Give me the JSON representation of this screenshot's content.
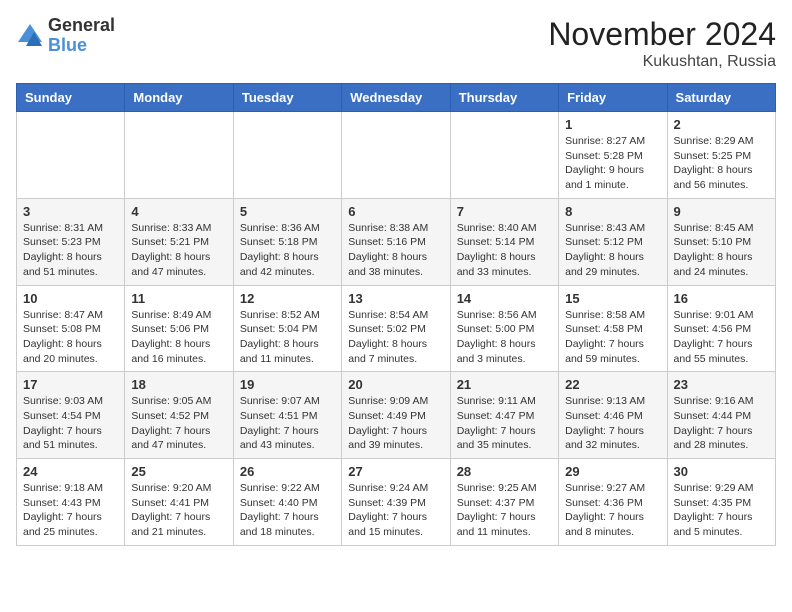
{
  "logo": {
    "general": "General",
    "blue": "Blue"
  },
  "title": "November 2024",
  "location": "Kukushtan, Russia",
  "days_header": [
    "Sunday",
    "Monday",
    "Tuesday",
    "Wednesday",
    "Thursday",
    "Friday",
    "Saturday"
  ],
  "weeks": [
    [
      {
        "day": "",
        "info": ""
      },
      {
        "day": "",
        "info": ""
      },
      {
        "day": "",
        "info": ""
      },
      {
        "day": "",
        "info": ""
      },
      {
        "day": "",
        "info": ""
      },
      {
        "day": "1",
        "info": "Sunrise: 8:27 AM\nSunset: 5:28 PM\nDaylight: 9 hours and 1 minute."
      },
      {
        "day": "2",
        "info": "Sunrise: 8:29 AM\nSunset: 5:25 PM\nDaylight: 8 hours and 56 minutes."
      }
    ],
    [
      {
        "day": "3",
        "info": "Sunrise: 8:31 AM\nSunset: 5:23 PM\nDaylight: 8 hours and 51 minutes."
      },
      {
        "day": "4",
        "info": "Sunrise: 8:33 AM\nSunset: 5:21 PM\nDaylight: 8 hours and 47 minutes."
      },
      {
        "day": "5",
        "info": "Sunrise: 8:36 AM\nSunset: 5:18 PM\nDaylight: 8 hours and 42 minutes."
      },
      {
        "day": "6",
        "info": "Sunrise: 8:38 AM\nSunset: 5:16 PM\nDaylight: 8 hours and 38 minutes."
      },
      {
        "day": "7",
        "info": "Sunrise: 8:40 AM\nSunset: 5:14 PM\nDaylight: 8 hours and 33 minutes."
      },
      {
        "day": "8",
        "info": "Sunrise: 8:43 AM\nSunset: 5:12 PM\nDaylight: 8 hours and 29 minutes."
      },
      {
        "day": "9",
        "info": "Sunrise: 8:45 AM\nSunset: 5:10 PM\nDaylight: 8 hours and 24 minutes."
      }
    ],
    [
      {
        "day": "10",
        "info": "Sunrise: 8:47 AM\nSunset: 5:08 PM\nDaylight: 8 hours and 20 minutes."
      },
      {
        "day": "11",
        "info": "Sunrise: 8:49 AM\nSunset: 5:06 PM\nDaylight: 8 hours and 16 minutes."
      },
      {
        "day": "12",
        "info": "Sunrise: 8:52 AM\nSunset: 5:04 PM\nDaylight: 8 hours and 11 minutes."
      },
      {
        "day": "13",
        "info": "Sunrise: 8:54 AM\nSunset: 5:02 PM\nDaylight: 8 hours and 7 minutes."
      },
      {
        "day": "14",
        "info": "Sunrise: 8:56 AM\nSunset: 5:00 PM\nDaylight: 8 hours and 3 minutes."
      },
      {
        "day": "15",
        "info": "Sunrise: 8:58 AM\nSunset: 4:58 PM\nDaylight: 7 hours and 59 minutes."
      },
      {
        "day": "16",
        "info": "Sunrise: 9:01 AM\nSunset: 4:56 PM\nDaylight: 7 hours and 55 minutes."
      }
    ],
    [
      {
        "day": "17",
        "info": "Sunrise: 9:03 AM\nSunset: 4:54 PM\nDaylight: 7 hours and 51 minutes."
      },
      {
        "day": "18",
        "info": "Sunrise: 9:05 AM\nSunset: 4:52 PM\nDaylight: 7 hours and 47 minutes."
      },
      {
        "day": "19",
        "info": "Sunrise: 9:07 AM\nSunset: 4:51 PM\nDaylight: 7 hours and 43 minutes."
      },
      {
        "day": "20",
        "info": "Sunrise: 9:09 AM\nSunset: 4:49 PM\nDaylight: 7 hours and 39 minutes."
      },
      {
        "day": "21",
        "info": "Sunrise: 9:11 AM\nSunset: 4:47 PM\nDaylight: 7 hours and 35 minutes."
      },
      {
        "day": "22",
        "info": "Sunrise: 9:13 AM\nSunset: 4:46 PM\nDaylight: 7 hours and 32 minutes."
      },
      {
        "day": "23",
        "info": "Sunrise: 9:16 AM\nSunset: 4:44 PM\nDaylight: 7 hours and 28 minutes."
      }
    ],
    [
      {
        "day": "24",
        "info": "Sunrise: 9:18 AM\nSunset: 4:43 PM\nDaylight: 7 hours and 25 minutes."
      },
      {
        "day": "25",
        "info": "Sunrise: 9:20 AM\nSunset: 4:41 PM\nDaylight: 7 hours and 21 minutes."
      },
      {
        "day": "26",
        "info": "Sunrise: 9:22 AM\nSunset: 4:40 PM\nDaylight: 7 hours and 18 minutes."
      },
      {
        "day": "27",
        "info": "Sunrise: 9:24 AM\nSunset: 4:39 PM\nDaylight: 7 hours and 15 minutes."
      },
      {
        "day": "28",
        "info": "Sunrise: 9:25 AM\nSunset: 4:37 PM\nDaylight: 7 hours and 11 minutes."
      },
      {
        "day": "29",
        "info": "Sunrise: 9:27 AM\nSunset: 4:36 PM\nDaylight: 7 hours and 8 minutes."
      },
      {
        "day": "30",
        "info": "Sunrise: 9:29 AM\nSunset: 4:35 PM\nDaylight: 7 hours and 5 minutes."
      }
    ]
  ]
}
